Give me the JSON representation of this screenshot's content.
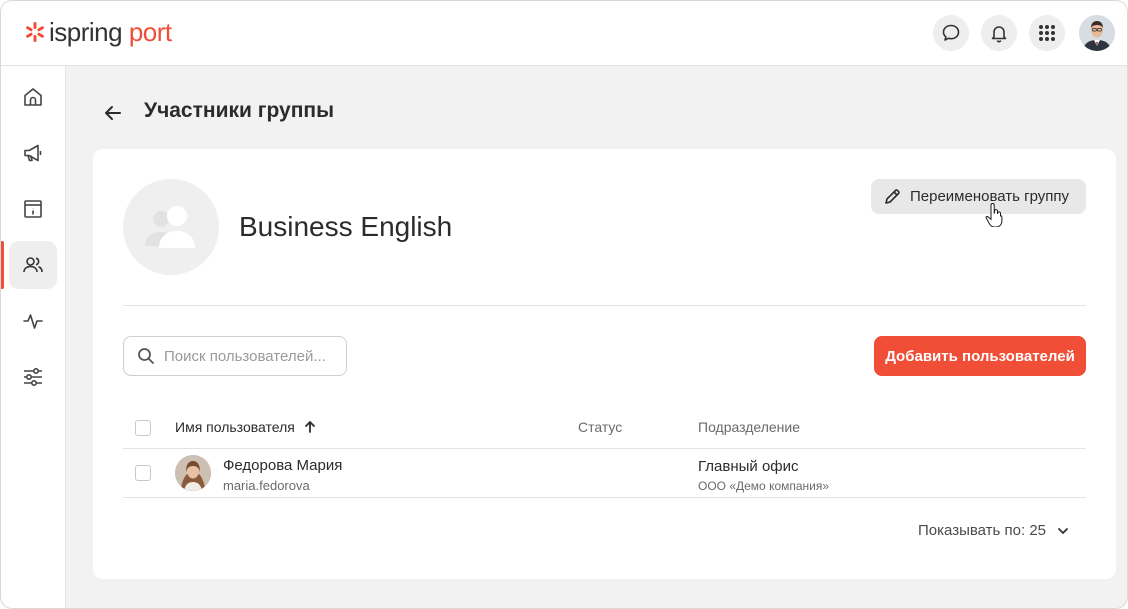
{
  "app": {
    "logo_part1": "ispring",
    "logo_part2": "port"
  },
  "topbar": {
    "icons": [
      "chat-icon",
      "bell-icon",
      "apps-grid-icon",
      "user-avatar"
    ]
  },
  "sidebar": {
    "items": [
      {
        "icon": "home-icon"
      },
      {
        "icon": "megaphone-icon"
      },
      {
        "icon": "info-box-icon"
      },
      {
        "icon": "users-icon",
        "active": true
      },
      {
        "icon": "activity-icon"
      },
      {
        "icon": "sliders-icon"
      }
    ]
  },
  "header": {
    "title": "Участники группы"
  },
  "group": {
    "name": "Business English",
    "rename_label": "Переименовать группу"
  },
  "search": {
    "placeholder": "Поиск пользователей...",
    "value": ""
  },
  "actions": {
    "add_users_label": "Добавить пользователей"
  },
  "table": {
    "columns": {
      "name": "Имя пользователя",
      "status": "Статус",
      "department": "Подразделение"
    },
    "rows": [
      {
        "name": "Федорова Мария",
        "login": "maria.fedorova",
        "status": "",
        "department": "Главный офис",
        "organization": "ООО «Демо компания»"
      }
    ]
  },
  "pagination": {
    "label": "Показывать по: 25"
  },
  "colors": {
    "accent": "#f04e37",
    "background": "#f2f2f2"
  }
}
